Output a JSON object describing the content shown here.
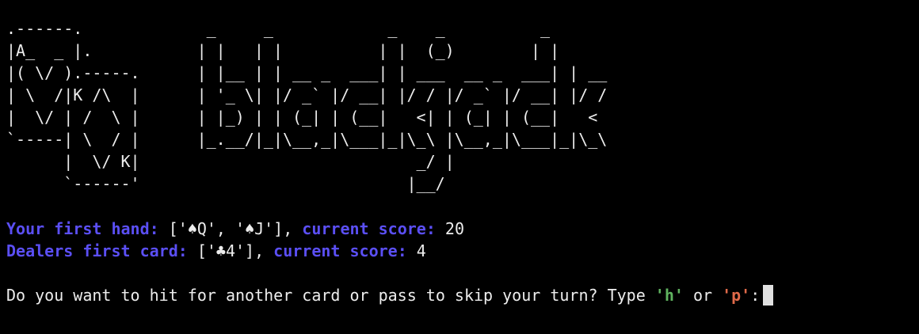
{
  "ascii": {
    "cards": ".------.\n|A_  _ |.\n|( \\/ ).-----.\n| \\  /|K /\\  |\n|  \\/ | /  \\ |\n`-----| \\  / |\n      |  \\/ K|\n      `------'",
    "logo": " _     _            _    _          _\n| |   | |          | |  (_)        | |\n| |__ | | __ _  ___| | ___  __ _  ___| | __\n| '_ \\| |/ _` |/ __| |/ / |/ _` |/ __| |/ /\n| |_) | | (_| | (__|   <| | (_| | (__|   <\n|_.__/|_|\\__,_|\\___|_|\\_\\ |\\__,_|\\___|_|\\_\\\n                       _/ |\n                      |__/"
  },
  "player": {
    "label": "Your first hand:",
    "cards": "['♠Q', '♠J']",
    "score_label": "current score:",
    "score": "20"
  },
  "dealer": {
    "label": "Dealers first card:",
    "cards": "['♣4']",
    "score_label": "current score:",
    "score": "4"
  },
  "prompt": {
    "text_before": "Do you want to hit for another card or pass to skip your turn? Type ",
    "hit_key": "'h'",
    "or_text": " or ",
    "pass_key": "'p'",
    "colon": ":"
  },
  "colors": {
    "label_blue": "#5b4ff5",
    "hit_green": "#5fb35f",
    "pass_red": "#e06a4a",
    "background": "#000000",
    "text": "#ededed"
  }
}
